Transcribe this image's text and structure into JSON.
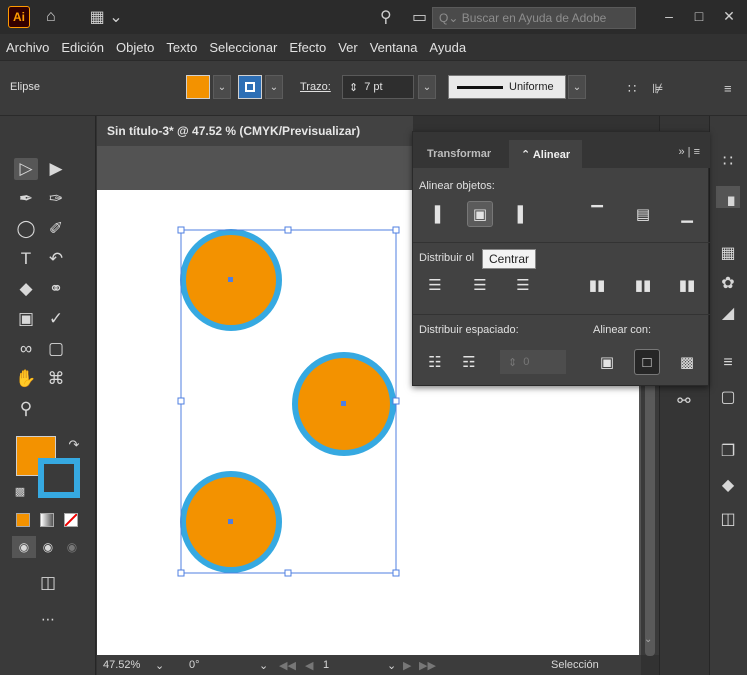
{
  "app": {
    "logo_text": "Ai"
  },
  "titlebar": {
    "search_placeholder": "Q⌄ Buscar en Ayuda de Adobe",
    "minimize": "–",
    "maximize": "□",
    "close": "✕"
  },
  "menu": [
    "Archivo",
    "Edición",
    "Objeto",
    "Texto",
    "Seleccionar",
    "Efecto",
    "Ver",
    "Ventana",
    "Ayuda"
  ],
  "control_bar": {
    "object_type": "Elipse",
    "fill_color": "#f39200",
    "stroke_color": "#36a9e1",
    "stroke_label": "Trazo:",
    "stroke_weight": "7 pt",
    "stroke_profile": "Uniforme"
  },
  "document": {
    "tab_title": "Sin título-3* @ 47.52 % (CMYK/Previsualizar)"
  },
  "status_bar": {
    "zoom": "47.52%",
    "rotation": "0°",
    "artboard": "1",
    "tool": "Selección"
  },
  "align_panel": {
    "tabs": [
      {
        "label": "Transformar",
        "active": false
      },
      {
        "label": "⌃ Alinear",
        "active": true
      }
    ],
    "section_align_objects": "Alinear objetos:",
    "section_distribute_objects": "Distribuir ol",
    "section_distribute_spacing": "Distribuir espaciado:",
    "section_align_to": "Alinear con:",
    "tooltip": "Centrar",
    "spacing_value": "0"
  },
  "canvas": {
    "circle_fill": "#f39200",
    "circle_stroke": "#36a9e1",
    "selection_color": "#4f7fe0"
  }
}
